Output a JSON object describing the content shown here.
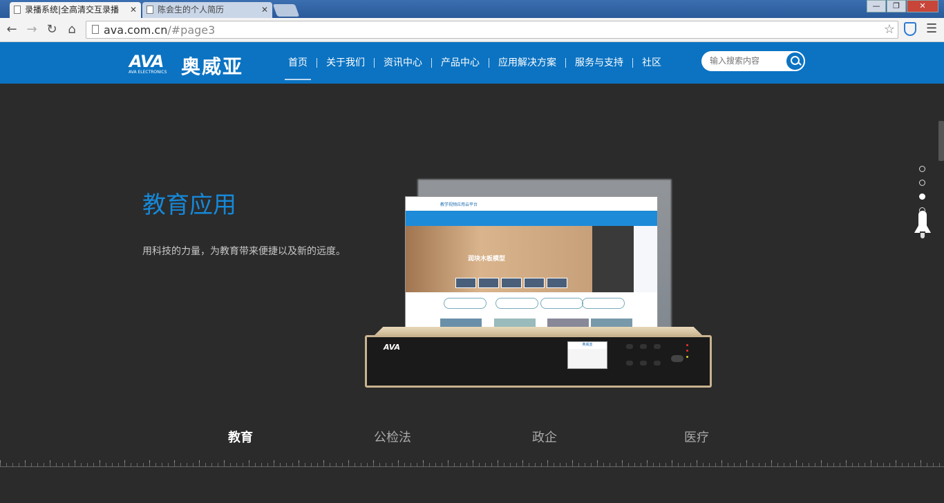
{
  "browser": {
    "tabs": [
      {
        "title": "录播系统|全高清交互录播",
        "active": true
      },
      {
        "title": "陈会生的个人简历",
        "active": false
      }
    ],
    "url_host": "ava.com.cn",
    "url_path": "/#page3",
    "window_buttons": {
      "minimize": "—",
      "maximize": "❐",
      "close": "✕"
    }
  },
  "site": {
    "logo_mark": "AVA",
    "logo_sub": "AVA ELECTRONICS",
    "logo_cn": "奥威亚",
    "nav": [
      {
        "label": "首页",
        "active": true
      },
      {
        "label": "关于我们"
      },
      {
        "label": "资讯中心"
      },
      {
        "label": "产品中心"
      },
      {
        "label": "应用解决方案"
      },
      {
        "label": "服务与支持"
      },
      {
        "label": "社区"
      }
    ],
    "search_placeholder": "输入搜索内容"
  },
  "hero": {
    "title": "教育应用",
    "description": "用科技的力量，为教育带来便捷以及新的远度。",
    "screen_header": "教学视频应用云平台",
    "screen_banner": "润块木板模型",
    "device_logo": "AVA",
    "device_lcd_header": "奥威亚"
  },
  "categories": [
    {
      "label": "教育",
      "active": true
    },
    {
      "label": "公检法"
    },
    {
      "label": "政企"
    },
    {
      "label": "医疗"
    }
  ],
  "pager": {
    "count": 4,
    "active_index": 2
  },
  "colors": {
    "header": "#0b73c2",
    "title_accent": "#1688d8",
    "background": "#2b2b2b"
  }
}
